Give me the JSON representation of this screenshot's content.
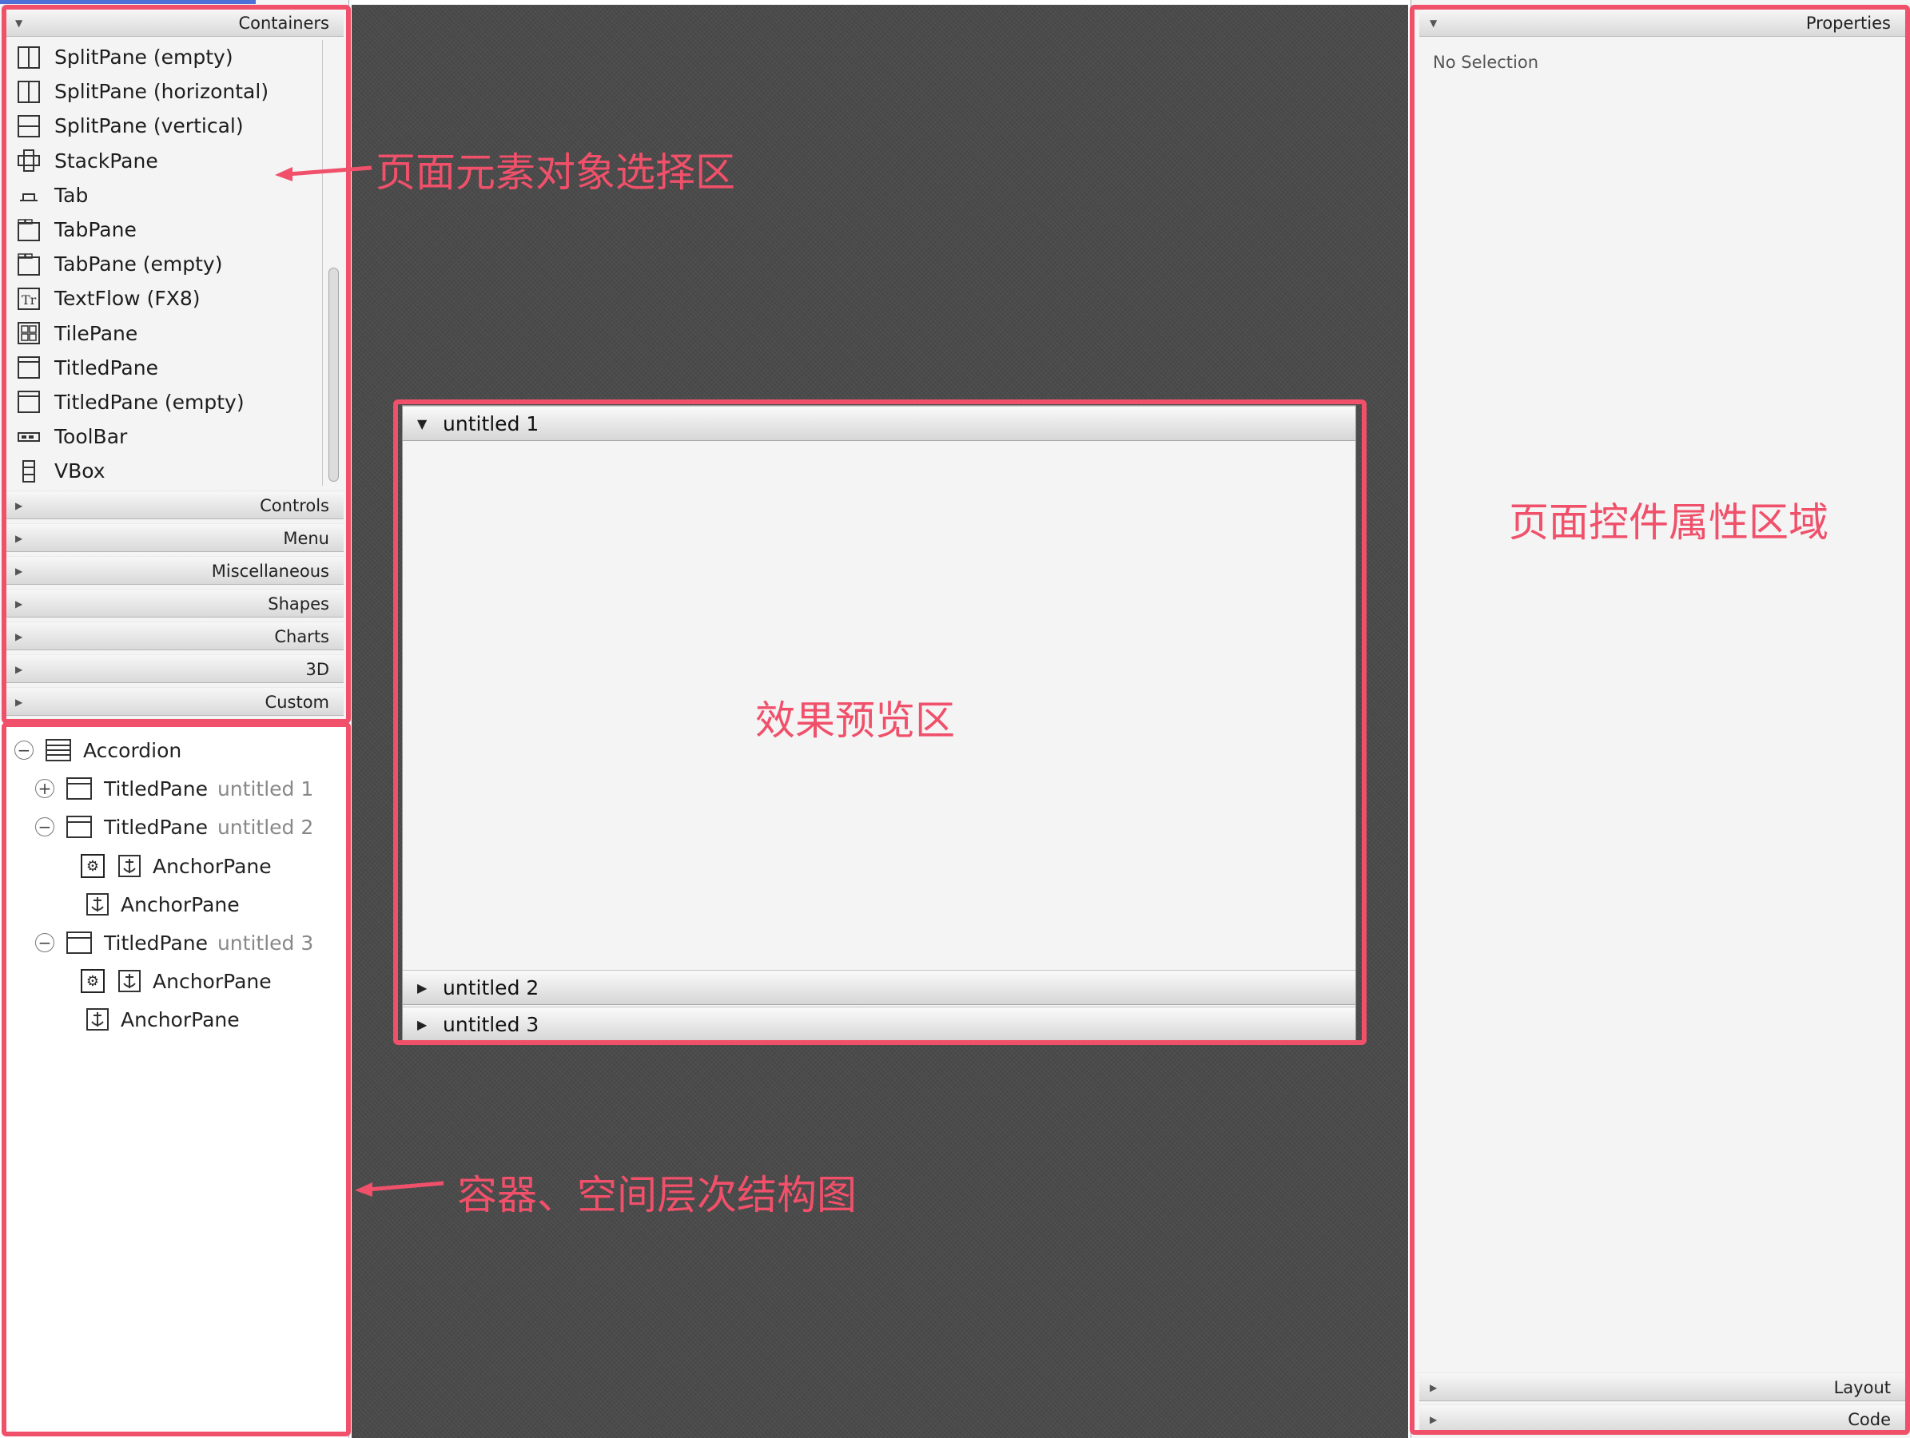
{
  "library": {
    "sections": [
      {
        "label": "Containers",
        "expanded": true
      },
      {
        "label": "Controls"
      },
      {
        "label": "Menu"
      },
      {
        "label": "Miscellaneous"
      },
      {
        "label": "Shapes"
      },
      {
        "label": "Charts"
      },
      {
        "label": "3D"
      },
      {
        "label": "Custom"
      }
    ],
    "container_items": [
      {
        "label": "SplitPane  (empty)",
        "icon": "splitpane-icon"
      },
      {
        "label": "SplitPane  (horizontal)",
        "icon": "splitpane-horizontal-icon"
      },
      {
        "label": "SplitPane  (vertical)",
        "icon": "splitpane-vertical-icon"
      },
      {
        "label": "StackPane",
        "icon": "stackpane-icon"
      },
      {
        "label": "Tab",
        "icon": "tab-icon"
      },
      {
        "label": "TabPane",
        "icon": "tabpane-icon"
      },
      {
        "label": "TabPane  (empty)",
        "icon": "tabpane-icon"
      },
      {
        "label": "TextFlow  (FX8)",
        "icon": "textflow-icon"
      },
      {
        "label": "TilePane",
        "icon": "tilepane-icon"
      },
      {
        "label": "TitledPane",
        "icon": "titledpane-icon"
      },
      {
        "label": "TitledPane  (empty)",
        "icon": "titledpane-icon"
      },
      {
        "label": "ToolBar",
        "icon": "toolbar-icon"
      },
      {
        "label": "VBox",
        "icon": "vbox-icon"
      }
    ]
  },
  "hierarchy": {
    "nodes": [
      {
        "type": "Accordion",
        "secondary": "",
        "toggle": "−"
      },
      {
        "type": "TitledPane",
        "secondary": "untitled 1",
        "toggle": "+"
      },
      {
        "type": "TitledPane",
        "secondary": "untitled 2",
        "toggle": "−"
      },
      {
        "type": "AnchorPane",
        "secondary": ""
      },
      {
        "type": "AnchorPane",
        "secondary": ""
      },
      {
        "type": "TitledPane",
        "secondary": "untitled 3",
        "toggle": "−"
      },
      {
        "type": "AnchorPane",
        "secondary": ""
      },
      {
        "type": "AnchorPane",
        "secondary": ""
      }
    ]
  },
  "canvas": {
    "accordion_panes": [
      "untitled 1",
      "untitled 2",
      "untitled 3"
    ]
  },
  "inspector": {
    "sections": [
      "Properties",
      "Layout",
      "Code"
    ],
    "empty_text": "No Selection"
  },
  "annotations": {
    "library_label": "页面元素对象选择区",
    "preview_label": "效果预览区",
    "hierarchy_label": "容器、空间层次结构图",
    "inspector_label": "页面控件属性区域",
    "color": "#f0506a"
  }
}
